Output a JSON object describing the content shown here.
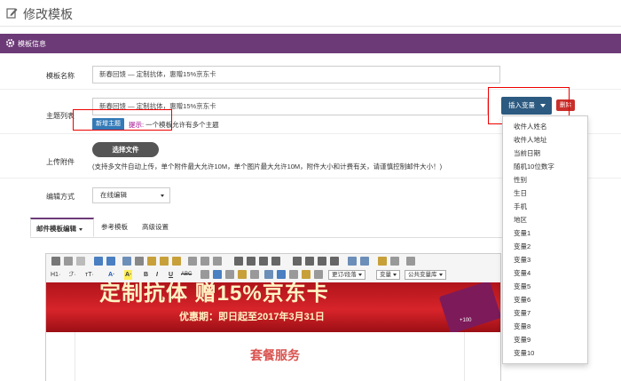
{
  "header": {
    "title": "修改模板",
    "icon": "edit-icon"
  },
  "panel": {
    "title": "模板信息",
    "icon": "gear-icon",
    "accent": "#6c3a77"
  },
  "form": {
    "name_label": "模板名称",
    "name_value": "新春回馈 — 定制抗体，惠赠15%京东卡",
    "topic_label": "主题列表",
    "topic_value": "新春回馈 — 定制抗体，惠赠15%京东卡",
    "insert_var_label": "插入变量",
    "delete_label": "删除",
    "add_topic_label": "新增主题",
    "hint_strong": "提示:",
    "hint_text": " 一个模板允许有多个主题",
    "attach_label": "上传附件",
    "choose_file_label": "选择文件",
    "attach_note": "(支持多文件自动上传，单个附件最大允许10M，单个图片最大允许10M，附件大小和计费有关，请谨慎控制邮件大小！)",
    "edit_mode_label": "编辑方式",
    "edit_mode_value": "在线编辑"
  },
  "tabs": [
    {
      "label": "邮件模板编辑"
    },
    {
      "label": "参考模板"
    },
    {
      "label": "高级设置"
    }
  ],
  "toolbar": {
    "h1_label": "H1·",
    "font_label": "ℱ·",
    "size_label": "тT·",
    "font_color_label": "A·",
    "bg_color_label": "A·",
    "bold_label": "B",
    "italic_label": "I",
    "underline_label": "U",
    "strike_label": "ABC",
    "combo_modify": "更订/段落",
    "combo_var": "变量",
    "combo_public": "公共变量库"
  },
  "banner": {
    "headline": "定制抗体 赠15%京东卡",
    "period": "优惠期：即日起至2017年3月31日",
    "card_text": "+100"
  },
  "content": {
    "service_title": "套餐服务"
  },
  "variables": [
    "收件人姓名",
    "收件人地址",
    "当前日期",
    "随机10位数字",
    "性别",
    "生日",
    "手机",
    "地区",
    "变量1",
    "变量2",
    "变量3",
    "变量4",
    "变量5",
    "变量6",
    "变量7",
    "变量8",
    "变量9",
    "变量10"
  ],
  "colors": {
    "primary": "#2d5a80",
    "danger": "#c9302c",
    "link": "#337ab7",
    "highlight_box": "#ee0000"
  }
}
